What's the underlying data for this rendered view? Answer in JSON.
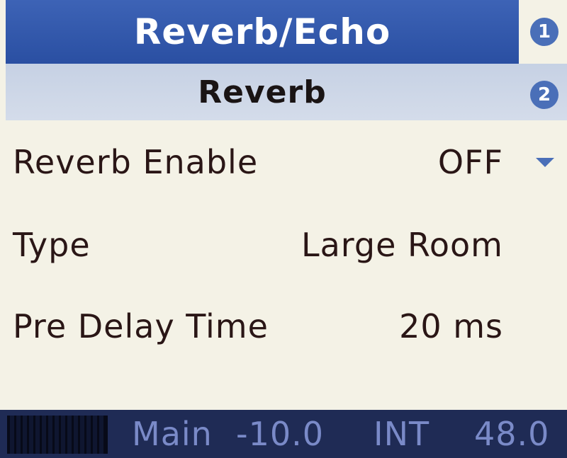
{
  "screen": {
    "title": "Reverb/Echo",
    "subtitle": "Reverb",
    "page_markers": [
      "1",
      "2"
    ]
  },
  "settings": [
    {
      "label": "Reverb Enable",
      "value": "OFF",
      "has_dropdown": true
    },
    {
      "label": "Type",
      "value": "Large Room"
    },
    {
      "label": "Pre Delay Time",
      "value": "20 ms"
    }
  ],
  "status_bar": {
    "output": "Main",
    "level": "-10.0",
    "clock_source": "INT",
    "sample_rate": "48.0"
  },
  "colors": {
    "title_bar": "#2f56a8",
    "subtitle_bar": "#cdd6e7",
    "background": "#f4f2e6",
    "text": "#2a1616",
    "accent": "#4a6fb8",
    "status_bar": "#1f2b55",
    "status_text": "#7a8ac8"
  },
  "icons": {
    "dropdown": "chevron-down-icon",
    "page_marker": "page-number-icon"
  }
}
